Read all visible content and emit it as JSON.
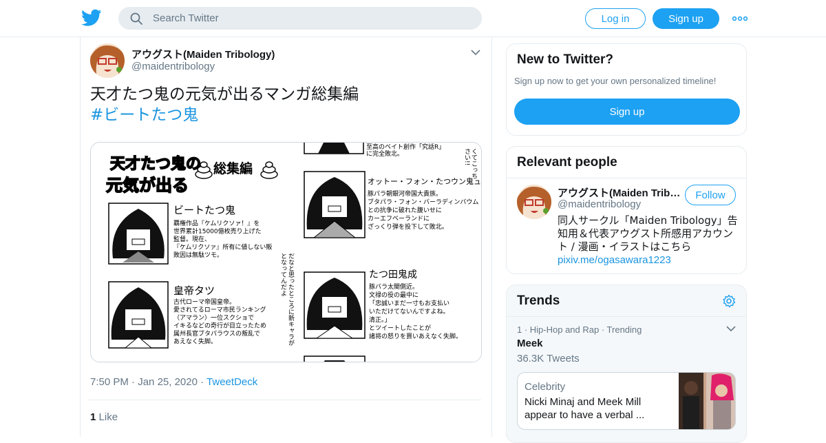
{
  "header": {
    "search_placeholder": "Search Twitter",
    "login_label": "Log in",
    "signup_label": "Sign up",
    "brand_color": "#1da1f2"
  },
  "tweet": {
    "user_name": "アウグスト(Maiden Tribology)",
    "handle": "@maidentribology",
    "text": "天才たつ鬼の元気が出るマンガ総集編",
    "hashtag": "#ビートたつ鬼",
    "time": "7:50 PM",
    "date": "Jan 25, 2020",
    "source": "TweetDeck",
    "like_count": "1",
    "like_label": "Like",
    "media": {
      "title_stylized": "天才たつ鬼の元気が出る",
      "title_suffix": "総集編",
      "vertical_note": "だなと思ったところに新キャラが\nとなってんだよ",
      "side_note": "くてこっち\nさい!!",
      "characters": [
        {
          "name": "ビートたつ鬼",
          "desc": [
            "覇権作品『ケムリクソァ！』を",
            "世界累計15000億枚売り上げた",
            "監督。現在、",
            "『ケムリクソァ』所有に値しない販",
            "敗因は無駄ツモ。"
          ]
        },
        {
          "name": "皇帝タツ",
          "desc": [
            "古代ローマ帝国皇帝。",
            "愛されてるローマ市民ランキング",
            "（アマラン）一位スクショで",
            "イキるなどの奇行が目立ったため",
            "属州長官ブタパラウスの叛乱で",
            "あえなく失脚。"
          ]
        },
        {
          "name": "オットー・フォン・たつウン鬼ュバイク",
          "desc": [
            "豚パラ朝銀河帝国大貴族。",
            "ブタパラ・フォン・バーラディンバウム（総護衛）",
            "との抗争に破れた腹いせに",
            "カーエフベーランドに",
            "ざっくり弾を投下して敗北。"
          ]
        },
        {
          "name": "たつ田鬼成",
          "desc": [
            "豚バラ太閤側近。",
            "文禄の役の最中に",
            "「忠誠いまだ一寸もお支払い",
            "いただけてないんですよね。",
            "清正。」",
            "とツイートしたことが",
            "諸将の怒りを買いあえなく失脚。"
          ]
        }
      ],
      "top_snippet": "至高のベイト創作「究話R」",
      "top_snippet2": "に完全敗北。"
    }
  },
  "new_to_twitter": {
    "heading": "New to Twitter?",
    "subtext": "Sign up now to get your own personalized timeline!",
    "button": "Sign up"
  },
  "relevant_people": {
    "heading": "Relevant people",
    "name": "アウグスト(Maiden Trib…",
    "handle": "@maidentribology",
    "follow_label": "Follow",
    "bio": "同人サークル「Maiden Tribology」告知用＆代表アウグスト所感用アカウント / 漫画・イラストはこちら",
    "link": "pixiv.me/ogasawara1223"
  },
  "trends": {
    "heading": "Trends",
    "items": [
      {
        "context": "1 · Hip-Hop and Rap · Trending",
        "name": "Meek",
        "count": "36.3K Tweets"
      }
    ],
    "news": {
      "category": "Celebrity",
      "title": "Nicki Minaj and Meek Mill appear to have a verbal ..."
    }
  }
}
